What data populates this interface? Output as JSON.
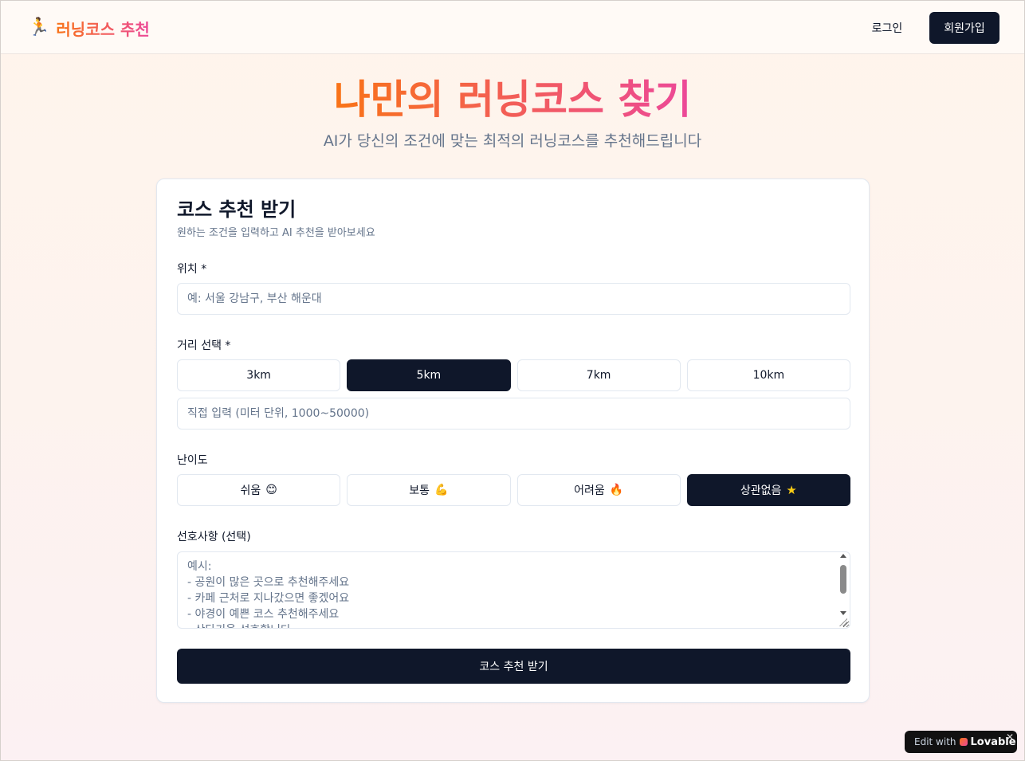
{
  "header": {
    "logo_icon": "🏃",
    "logo_text": "러닝코스 추천",
    "login_label": "로그인",
    "signup_label": "회원가입"
  },
  "hero": {
    "title": "나만의 러닝코스 찾기",
    "subtitle": "AI가 당신의 조건에 맞는 최적의 러닝코스를 추천해드립니다"
  },
  "form": {
    "title": "코스 추천 받기",
    "description": "원하는 조건을 입력하고 AI 추천을 받아보세요",
    "location": {
      "label": "위치 *",
      "placeholder": "예: 서울 강남구, 부산 해운대"
    },
    "distance": {
      "label": "거리 선택 *",
      "options": [
        "3km",
        "5km",
        "7km",
        "10km"
      ],
      "selected": "5km",
      "custom_placeholder": "직접 입력 (미터 단위, 1000~50000)"
    },
    "difficulty": {
      "label": "난이도",
      "options": [
        {
          "label": "쉬움",
          "emoji": "😊"
        },
        {
          "label": "보통",
          "emoji": "💪"
        },
        {
          "label": "어려움",
          "emoji": "🔥"
        },
        {
          "label": "상관없음",
          "emoji": "★"
        }
      ],
      "selected": "상관없음"
    },
    "preferences": {
      "label": "선호사항 (선택)",
      "placeholder": "예시:\n- 공원이 많은 곳으로 추천해주세요\n- 카페 근처로 지나갔으면 좋겠어요\n- 야경이 예쁜 코스 추천해주세요\n- 산타기을 선호합니다"
    },
    "submit_label": "코스 추천 받기"
  },
  "badge": {
    "edit_text": "Edit with",
    "brand": "Lovable",
    "close": "✕"
  },
  "colors": {
    "primary": "#0f172a",
    "gradient_start": "#f97316",
    "gradient_end": "#ec4899",
    "muted": "#64748b"
  }
}
